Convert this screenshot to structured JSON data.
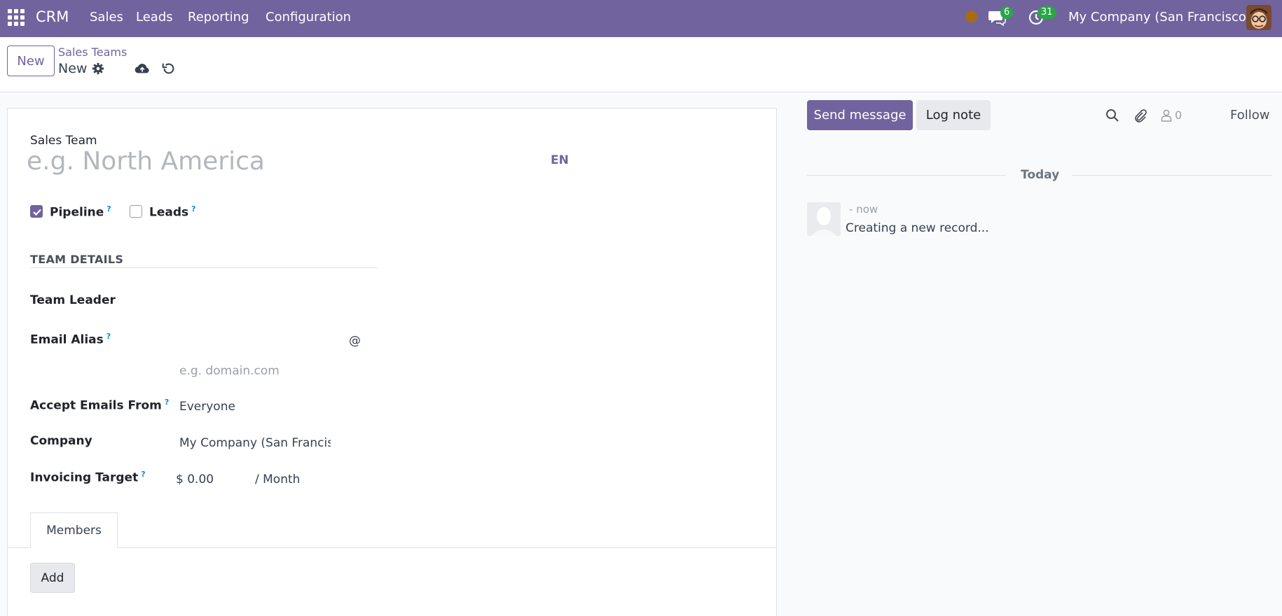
{
  "navbar": {
    "brand": "CRM",
    "menus": [
      "Sales",
      "Leads",
      "Reporting",
      "Configuration"
    ],
    "chat_badge": "6",
    "activity_badge": "31",
    "company": "My Company (San Francisco)",
    "status_color": "#a56d10",
    "bg_color": "#71639e"
  },
  "control_panel": {
    "new_button": "New",
    "breadcrumb": "Sales Teams",
    "record_name": "New"
  },
  "form": {
    "sales_team_label": "Sales Team",
    "name_placeholder": "e.g. North America",
    "lang": "EN",
    "pipeline_label": "Pipeline",
    "pipeline_checked": true,
    "leads_label": "Leads",
    "leads_checked": false,
    "help_mark": "?",
    "section_title": "TEAM DETAILS",
    "team_leader_label": "Team Leader",
    "email_alias_label": "Email Alias",
    "at_sign": "@",
    "domain_placeholder": "e.g. domain.com",
    "accept_emails_label": "Accept Emails From",
    "accept_emails_value": "Everyone",
    "company_label": "Company",
    "company_value": "My Company (San Francisc",
    "invoicing_target_label": "Invoicing Target",
    "invoicing_target_value": "$ 0.00",
    "invoicing_target_unit": "/ Month",
    "tab_members": "Members",
    "add_button": "Add"
  },
  "chatter": {
    "send_message": "Send message",
    "log_note": "Log note",
    "follower_count": "0",
    "follow": "Follow",
    "today": "Today",
    "message_time": "- now",
    "message_body": "Creating a new record..."
  }
}
